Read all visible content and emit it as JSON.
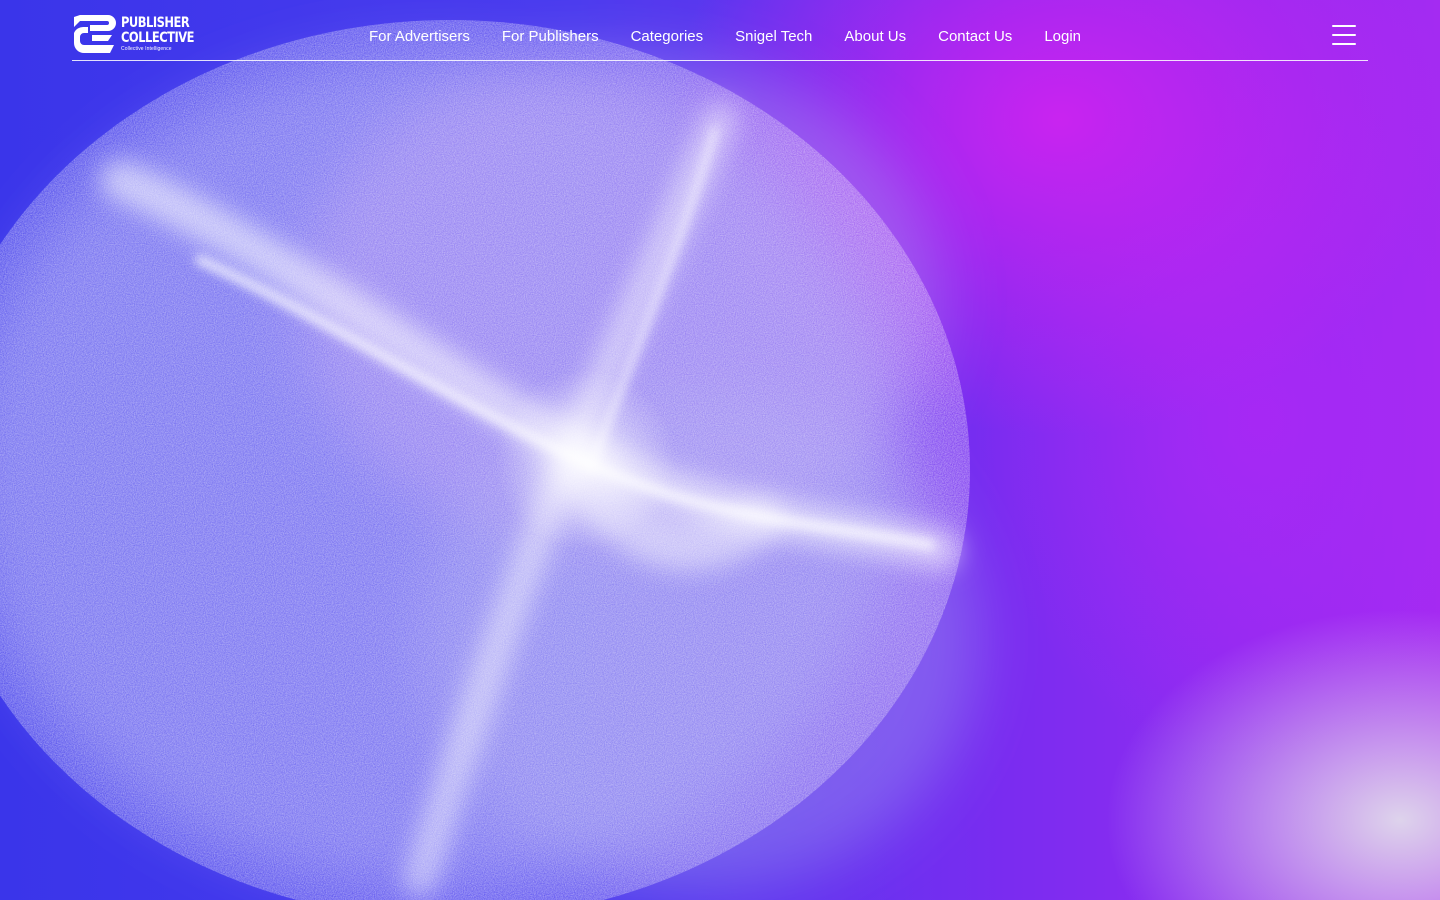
{
  "brand": {
    "line1": "PUBLISHER",
    "line2": "COLLECTIVE",
    "tagline": "Collective Intelligence",
    "logo_icon": "publisher-collective-logo-icon"
  },
  "nav": {
    "items": [
      {
        "label": "For Advertisers"
      },
      {
        "label": "For Publishers"
      },
      {
        "label": "Categories"
      },
      {
        "label": "Snigel Tech"
      },
      {
        "label": "About Us"
      },
      {
        "label": "Contact Us"
      },
      {
        "label": "Login"
      }
    ],
    "menu_icon": "hamburger-menu-icon"
  },
  "colors": {
    "primary_blue": "#3a35ea",
    "magenta": "#cd23f0",
    "text": "#ffffff"
  }
}
